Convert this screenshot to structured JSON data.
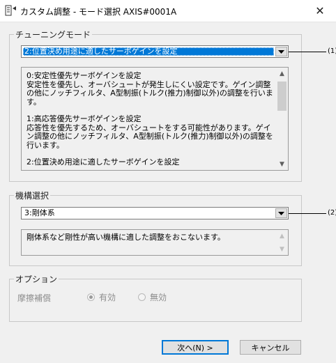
{
  "window": {
    "title": "カスタム調整 - モード選択 AXIS#0001A",
    "close_icon": "close-icon"
  },
  "tuning_mode": {
    "legend": "チューニングモード",
    "selected": "2:位置決め用途に適したサーボゲインを設定",
    "callout": "(1)",
    "options": [
      {
        "title": "0:安定性優先サーボゲインを設定",
        "lines": [
          "安定性を優先し、オーバシュートが発生しにくい設定です。ゲイン調整",
          "の他にノッチフィルタ、A型制振(トルク(推力)制御以外)の調整を行いま",
          "す。"
        ]
      },
      {
        "title": "1:高応答優先サーボゲインを設定",
        "lines": [
          "応答性を優先するため、オーバシュートをする可能性があります。ゲイ",
          "ン調整の他にノッチフィルタ、A型制振(トルク(推力)制御以外)の調整を",
          "行います。"
        ]
      },
      {
        "title": "2:位置決め用途に適したサーボゲインを設定",
        "lines": []
      }
    ]
  },
  "mechanism": {
    "legend": "機構選択",
    "selected": "3:剛体系",
    "callout": "(2)",
    "description": "剛体系など剛性が高い機構に適した調整をおこないます。"
  },
  "options": {
    "legend": "オプション",
    "friction_label": "摩擦補償",
    "enabled_label": "有効",
    "disabled_label": "無効",
    "enabled_selected": true
  },
  "buttons": {
    "next": "次へ(N) >",
    "cancel": "キャンセル"
  },
  "colors": {
    "highlight": "#0078d7",
    "background": "#f0f0f0"
  }
}
